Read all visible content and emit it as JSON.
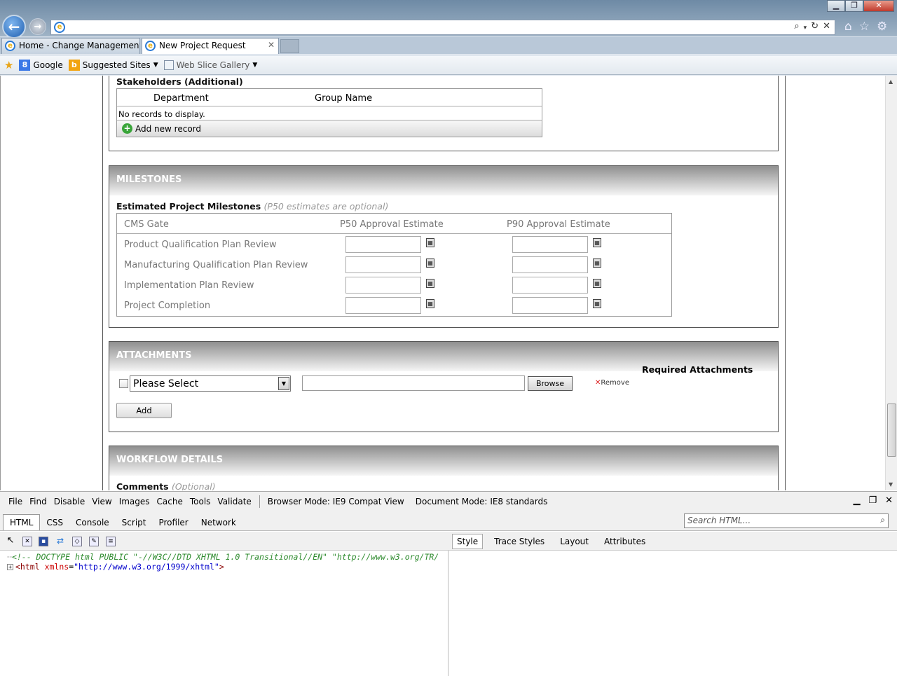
{
  "browser": {
    "tabs": [
      {
        "label": "Home - Change Management ..."
      },
      {
        "label": "New Project Request"
      }
    ],
    "favorites": {
      "google": "Google",
      "suggested": "Suggested Sites",
      "webslice": "Web Slice Gallery"
    }
  },
  "stakeholders": {
    "title": "Stakeholders (Additional)",
    "columns": [
      "Department",
      "Group Name"
    ],
    "empty_text": "No records to display.",
    "add_label": "Add new record"
  },
  "milestones": {
    "section_title": "MILESTONES",
    "sublabel": "Estimated Project Milestones",
    "sublabel_note": "(P50 estimates are optional)",
    "columns": [
      "CMS Gate",
      "P50 Approval Estimate",
      "P90 Approval Estimate"
    ],
    "rows": [
      {
        "gate": "Product Qualification Plan Review"
      },
      {
        "gate": "Manufacturing Qualification Plan Review"
      },
      {
        "gate": "Implementation Plan Review"
      },
      {
        "gate": "Project Completion"
      }
    ]
  },
  "attachments": {
    "section_title": "ATTACHMENTS",
    "required_label": "Required Attachments",
    "select_value": "Please Select",
    "browse_label": "Browse",
    "remove_label": "Remove",
    "add_label": "Add"
  },
  "workflow": {
    "section_title": "WORKFLOW DETAILS",
    "comments_label": "Comments",
    "comments_note": "(Optional)"
  },
  "devtools": {
    "menu": [
      "File",
      "Find",
      "Disable",
      "View",
      "Images",
      "Cache",
      "Tools",
      "Validate"
    ],
    "browser_mode_label": "Browser Mode:",
    "browser_mode_value": "IE9 Compat View",
    "document_mode_label": "Document Mode:",
    "document_mode_value": "IE8 standards",
    "tabs": [
      "HTML",
      "CSS",
      "Console",
      "Script",
      "Profiler",
      "Network"
    ],
    "search_placeholder": "Search HTML...",
    "right_tabs": [
      "Style",
      "Trace Styles",
      "Layout",
      "Attributes"
    ],
    "code_line1": "<!-- DOCTYPE html PUBLIC \"-//W3C//DTD XHTML 1.0 Transitional//EN\" \"http://www.w3.org/TR/",
    "code_tag_open": "<html",
    "code_attr": "xmlns",
    "code_val": "\"http://www.w3.org/1999/xhtml\"",
    "code_tag_close": ">"
  }
}
